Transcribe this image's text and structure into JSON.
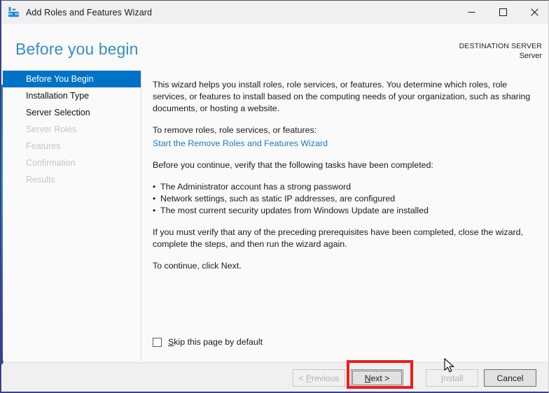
{
  "window": {
    "title": "Add Roles and Features Wizard",
    "icon": "server-manager-toolbox-icon",
    "minimize_label": "Minimize",
    "maximize_label": "Maximize",
    "close_label": "Close"
  },
  "header": {
    "page_title": "Before you begin",
    "destination_label": "DESTINATION SERVER",
    "destination_value": "Server"
  },
  "sidebar": {
    "items": [
      {
        "label": "Before You Begin",
        "state": "selected"
      },
      {
        "label": "Installation Type",
        "state": "enabled"
      },
      {
        "label": "Server Selection",
        "state": "enabled"
      },
      {
        "label": "Server Roles",
        "state": "disabled"
      },
      {
        "label": "Features",
        "state": "disabled"
      },
      {
        "label": "Confirmation",
        "state": "disabled"
      },
      {
        "label": "Results",
        "state": "disabled"
      }
    ]
  },
  "content": {
    "intro": "This wizard helps you install roles, role services, or features. You determine which roles, role services, or features to install based on the computing needs of your organization, such as sharing documents, or hosting a website.",
    "remove_prompt": "To remove roles, role services, or features:",
    "remove_link": "Start the Remove Roles and Features Wizard",
    "verify_prompt": "Before you continue, verify that the following tasks have been completed:",
    "tasks": [
      "The Administrator account has a strong password",
      "Network settings, such as static IP addresses, are configured",
      "The most current security updates from Windows Update are installed"
    ],
    "prereq_note": "If you must verify that any of the preceding prerequisites have been completed, close the wizard, complete the steps, and then run the wizard again.",
    "continue_note": "To continue, click Next.",
    "skip_checkbox_label": "Skip this page by default",
    "skip_checkbox_accelerator": "S",
    "skip_checkbox_checked": false
  },
  "footer": {
    "buttons": [
      {
        "label": "< Previous",
        "accelerator": "P",
        "state": "disabled"
      },
      {
        "label": "Next >",
        "accelerator": "N",
        "state": "focused"
      },
      {
        "label": "Install",
        "accelerator": "I",
        "state": "disabled"
      },
      {
        "label": "Cancel",
        "accelerator": "",
        "state": "enabled"
      }
    ]
  },
  "annotation": {
    "target": "Next >",
    "color": "#ee1c1c"
  },
  "colors": {
    "accent_blue": "#0072c6",
    "title_blue": "#3a8dc0",
    "link_blue": "#1f79c0",
    "titlebar_bg": "#f0f0f0",
    "body_bg": "#fafafa",
    "footer_bg": "#f0f0f0",
    "disabled_text": "#c6c6c6",
    "annotation_red": "#ee1c1c"
  }
}
